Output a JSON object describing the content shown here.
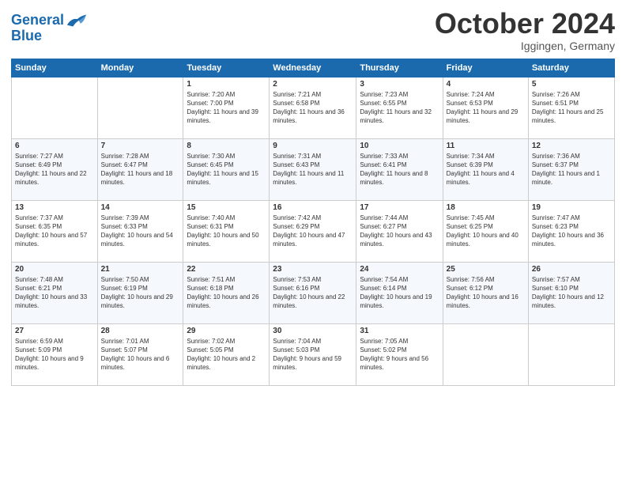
{
  "header": {
    "logo_line1": "General",
    "logo_line2": "Blue",
    "month": "October 2024",
    "location": "Iggingen, Germany"
  },
  "weekdays": [
    "Sunday",
    "Monday",
    "Tuesday",
    "Wednesday",
    "Thursday",
    "Friday",
    "Saturday"
  ],
  "weeks": [
    [
      {
        "day": "",
        "info": ""
      },
      {
        "day": "",
        "info": ""
      },
      {
        "day": "1",
        "info": "Sunrise: 7:20 AM\nSunset: 7:00 PM\nDaylight: 11 hours and 39 minutes."
      },
      {
        "day": "2",
        "info": "Sunrise: 7:21 AM\nSunset: 6:58 PM\nDaylight: 11 hours and 36 minutes."
      },
      {
        "day": "3",
        "info": "Sunrise: 7:23 AM\nSunset: 6:55 PM\nDaylight: 11 hours and 32 minutes."
      },
      {
        "day": "4",
        "info": "Sunrise: 7:24 AM\nSunset: 6:53 PM\nDaylight: 11 hours and 29 minutes."
      },
      {
        "day": "5",
        "info": "Sunrise: 7:26 AM\nSunset: 6:51 PM\nDaylight: 11 hours and 25 minutes."
      }
    ],
    [
      {
        "day": "6",
        "info": "Sunrise: 7:27 AM\nSunset: 6:49 PM\nDaylight: 11 hours and 22 minutes."
      },
      {
        "day": "7",
        "info": "Sunrise: 7:28 AM\nSunset: 6:47 PM\nDaylight: 11 hours and 18 minutes."
      },
      {
        "day": "8",
        "info": "Sunrise: 7:30 AM\nSunset: 6:45 PM\nDaylight: 11 hours and 15 minutes."
      },
      {
        "day": "9",
        "info": "Sunrise: 7:31 AM\nSunset: 6:43 PM\nDaylight: 11 hours and 11 minutes."
      },
      {
        "day": "10",
        "info": "Sunrise: 7:33 AM\nSunset: 6:41 PM\nDaylight: 11 hours and 8 minutes."
      },
      {
        "day": "11",
        "info": "Sunrise: 7:34 AM\nSunset: 6:39 PM\nDaylight: 11 hours and 4 minutes."
      },
      {
        "day": "12",
        "info": "Sunrise: 7:36 AM\nSunset: 6:37 PM\nDaylight: 11 hours and 1 minute."
      }
    ],
    [
      {
        "day": "13",
        "info": "Sunrise: 7:37 AM\nSunset: 6:35 PM\nDaylight: 10 hours and 57 minutes."
      },
      {
        "day": "14",
        "info": "Sunrise: 7:39 AM\nSunset: 6:33 PM\nDaylight: 10 hours and 54 minutes."
      },
      {
        "day": "15",
        "info": "Sunrise: 7:40 AM\nSunset: 6:31 PM\nDaylight: 10 hours and 50 minutes."
      },
      {
        "day": "16",
        "info": "Sunrise: 7:42 AM\nSunset: 6:29 PM\nDaylight: 10 hours and 47 minutes."
      },
      {
        "day": "17",
        "info": "Sunrise: 7:44 AM\nSunset: 6:27 PM\nDaylight: 10 hours and 43 minutes."
      },
      {
        "day": "18",
        "info": "Sunrise: 7:45 AM\nSunset: 6:25 PM\nDaylight: 10 hours and 40 minutes."
      },
      {
        "day": "19",
        "info": "Sunrise: 7:47 AM\nSunset: 6:23 PM\nDaylight: 10 hours and 36 minutes."
      }
    ],
    [
      {
        "day": "20",
        "info": "Sunrise: 7:48 AM\nSunset: 6:21 PM\nDaylight: 10 hours and 33 minutes."
      },
      {
        "day": "21",
        "info": "Sunrise: 7:50 AM\nSunset: 6:19 PM\nDaylight: 10 hours and 29 minutes."
      },
      {
        "day": "22",
        "info": "Sunrise: 7:51 AM\nSunset: 6:18 PM\nDaylight: 10 hours and 26 minutes."
      },
      {
        "day": "23",
        "info": "Sunrise: 7:53 AM\nSunset: 6:16 PM\nDaylight: 10 hours and 22 minutes."
      },
      {
        "day": "24",
        "info": "Sunrise: 7:54 AM\nSunset: 6:14 PM\nDaylight: 10 hours and 19 minutes."
      },
      {
        "day": "25",
        "info": "Sunrise: 7:56 AM\nSunset: 6:12 PM\nDaylight: 10 hours and 16 minutes."
      },
      {
        "day": "26",
        "info": "Sunrise: 7:57 AM\nSunset: 6:10 PM\nDaylight: 10 hours and 12 minutes."
      }
    ],
    [
      {
        "day": "27",
        "info": "Sunrise: 6:59 AM\nSunset: 5:09 PM\nDaylight: 10 hours and 9 minutes."
      },
      {
        "day": "28",
        "info": "Sunrise: 7:01 AM\nSunset: 5:07 PM\nDaylight: 10 hours and 6 minutes."
      },
      {
        "day": "29",
        "info": "Sunrise: 7:02 AM\nSunset: 5:05 PM\nDaylight: 10 hours and 2 minutes."
      },
      {
        "day": "30",
        "info": "Sunrise: 7:04 AM\nSunset: 5:03 PM\nDaylight: 9 hours and 59 minutes."
      },
      {
        "day": "31",
        "info": "Sunrise: 7:05 AM\nSunset: 5:02 PM\nDaylight: 9 hours and 56 minutes."
      },
      {
        "day": "",
        "info": ""
      },
      {
        "day": "",
        "info": ""
      }
    ]
  ]
}
